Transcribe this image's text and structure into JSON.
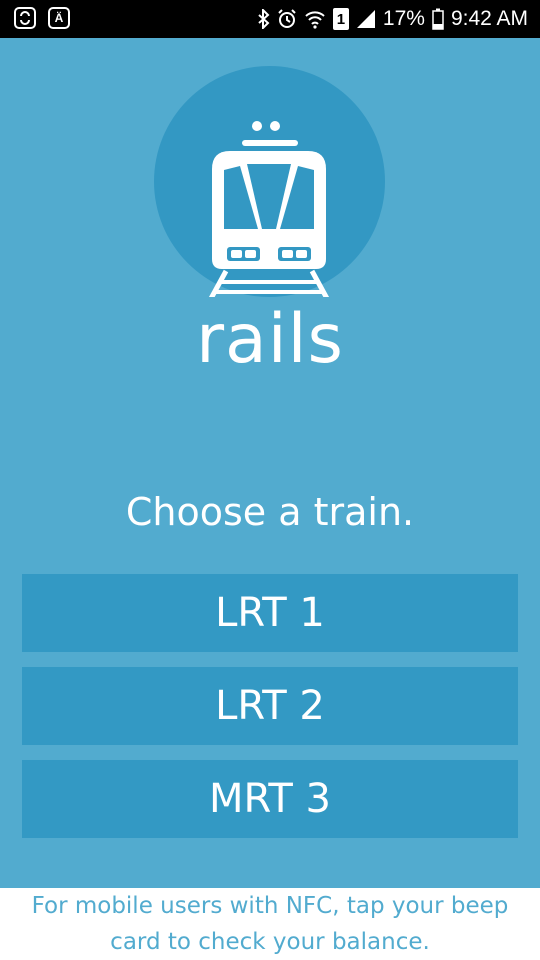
{
  "status_bar": {
    "left_icons": [
      "sync-icon",
      "auto-text-icon"
    ],
    "left_box_texts": [
      "",
      "Ä"
    ],
    "right_icons": [
      "bluetooth-icon",
      "alarm-icon",
      "wifi-icon",
      "sim-icon",
      "signal-icon",
      "battery-icon"
    ],
    "sim_label": "1",
    "battery": "17%",
    "time": "9:42 AM"
  },
  "app": {
    "name": "rails",
    "prompt": "Choose a train.",
    "logo_icon": "train-icon"
  },
  "trains": [
    {
      "label": "LRT 1"
    },
    {
      "label": "LRT 2"
    },
    {
      "label": "MRT 3"
    }
  ],
  "footer": {
    "line1": "For mobile users with NFC, tap your beep",
    "line2": "card to check your balance."
  },
  "colors": {
    "background": "#52abcf",
    "button": "#3399c4",
    "logo_circle": "#3398c3",
    "footer_text": "#52abcf"
  }
}
